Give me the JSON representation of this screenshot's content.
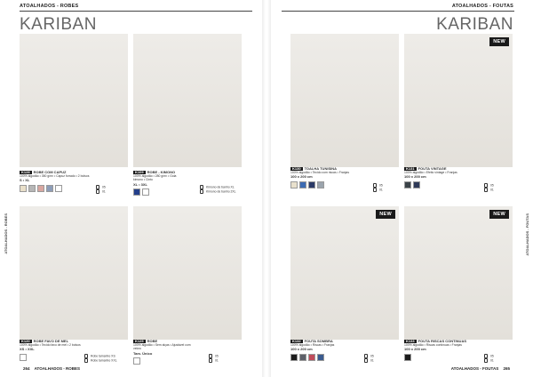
{
  "left_page": {
    "header": "ATOALHADOS - ROBES",
    "brand": "KARIBAN",
    "side_tab": "ATOALHADOS - ROBES",
    "footer_page": "264",
    "footer_section": "ATOALHADOS - ROBES",
    "products": [
      {
        "code": "K128",
        "name": "ROBE COM CAPUZ",
        "desc": "100% algodão • 350 g/m² • Capuz forrado • 2 bolsos",
        "sizes": "S • XL",
        "swatches": [
          "#e9dfc9",
          "#b6b6b6",
          "#d8a6a0",
          "#8d9db8",
          "#ffffff"
        ],
        "pack": [
          "05",
          "01"
        ]
      },
      {
        "code": "K109",
        "name": "ROBE - KIMONO",
        "desc": "100% algodão • 280 g/m² • Gola kimono • Cinto",
        "sizes": "XL • 3XL",
        "swatches": [
          "#233f8b",
          "#ffffff"
        ],
        "pack": [
          "Kimono de banho XL",
          "Kimono de banho 2XL"
        ]
      },
      {
        "code": "K120",
        "name": "ROBE FAVO DE MEL",
        "desc": "100% algodão • Tecido favo de mel • 2 bolsos",
        "sizes": "XS • XXL",
        "swatches": [
          "#ffffff"
        ],
        "pack": [
          "Robe tamanho XS",
          "Robe tamanho XXL"
        ]
      },
      {
        "code": "K125",
        "name": "ROBE",
        "desc": "100% algodão • Sem alças • Ajustável com velcro",
        "sizes": "Tam. Único",
        "swatches": [
          "#ffffff"
        ],
        "pack": [
          "05",
          "01"
        ]
      }
    ]
  },
  "right_page": {
    "header": "ATOALHADOS - FOUTAS",
    "brand": "KARIBAN",
    "side_tab": "ATOALHADOS - FOUTAS",
    "footer_section": "ATOALHADOS - FOUTAS",
    "footer_page": "265",
    "new_label": "NEW",
    "products": [
      {
        "code": "K130",
        "name": "TOALHA TUNISINA",
        "desc": "100% algodão • Tecido com riscas • Franjas",
        "sizes": "100 x 200 cm",
        "swatches": [
          "#e8e0cc",
          "#3c6bb3",
          "#2b3a67",
          "#9ba4ad"
        ],
        "pack": [
          "05",
          "01"
        ]
      },
      {
        "code": "K131",
        "name": "FOUTA VINTAGE",
        "desc": "100% algodão • Efeito vintage • Franjas",
        "sizes": "100 x 200 cm",
        "swatches": [
          "#3b4348",
          "#2e3957"
        ],
        "pack": [
          "05",
          "01"
        ]
      },
      {
        "code": "K132",
        "name": "FOUTA SOMBRA",
        "desc": "100% algodão • Riscas • Franjas",
        "sizes": "100 x 200 cm",
        "swatches": [
          "#1c1c1c",
          "#5c5f68",
          "#c04c5b",
          "#3a5b8f"
        ],
        "pack": [
          "05",
          "01"
        ]
      },
      {
        "code": "K133",
        "name": "FOUTA RISCAS CONTINUAS",
        "desc": "100% algodão • Riscas contínuas • Franjas",
        "sizes": "100 x 200 cm",
        "swatches": [
          "#1c1c1c"
        ],
        "pack": [
          "05",
          "01"
        ]
      }
    ]
  }
}
